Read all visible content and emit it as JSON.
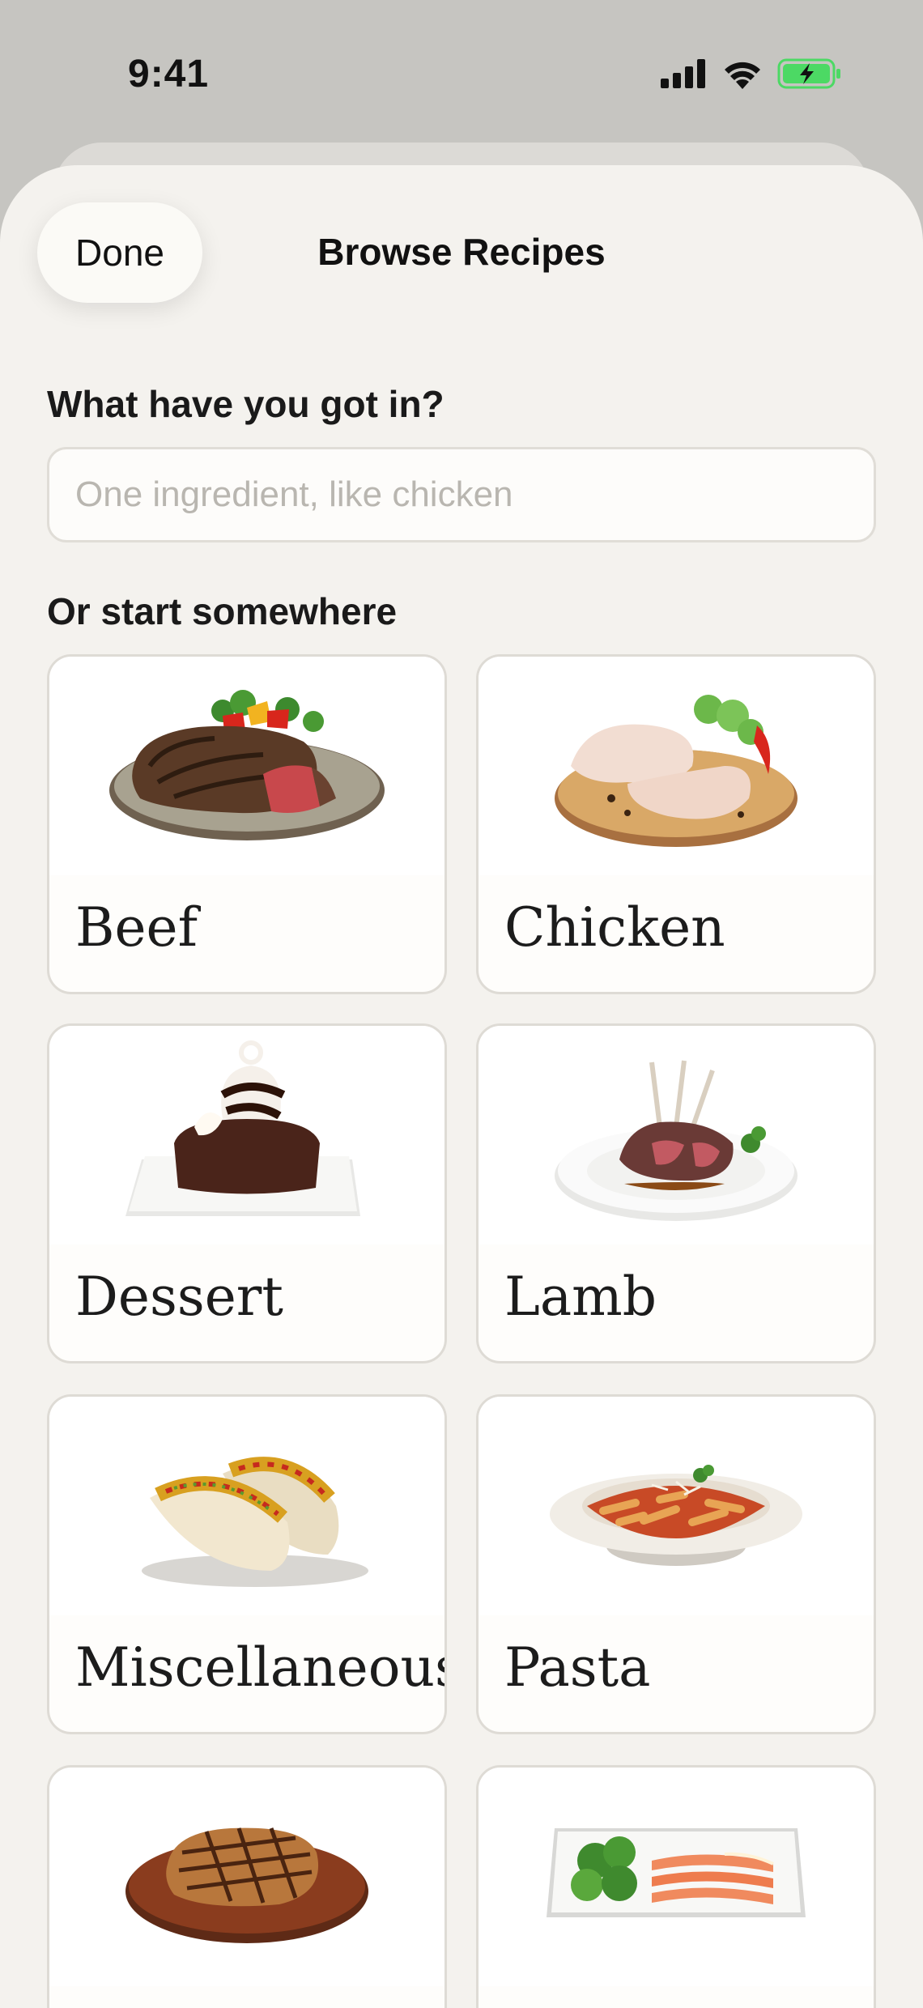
{
  "status": {
    "time": "9:41"
  },
  "sheet": {
    "title": "Browse Recipes",
    "done_label": "Done"
  },
  "search": {
    "label": "What have you got in?",
    "placeholder": "One ingredient, like chicken",
    "value": ""
  },
  "categories_label": "Or start somewhere",
  "categories": [
    {
      "label": "Beef",
      "image": "steak-plate"
    },
    {
      "label": "Chicken",
      "image": "raw-chicken-legs"
    },
    {
      "label": "Dessert",
      "image": "chocolate-sundae"
    },
    {
      "label": "Lamb",
      "image": "lamb-chops"
    },
    {
      "label": "Miscellaneous",
      "image": "tacos"
    },
    {
      "label": "Pasta",
      "image": "penne-pasta"
    },
    {
      "label": "",
      "image": "pork-chop-board"
    },
    {
      "label": "",
      "image": "salmon-platter"
    }
  ],
  "colors": {
    "background": "#f4f2ee",
    "card": "#fefdfb",
    "accent_battery": "#4cd964"
  }
}
